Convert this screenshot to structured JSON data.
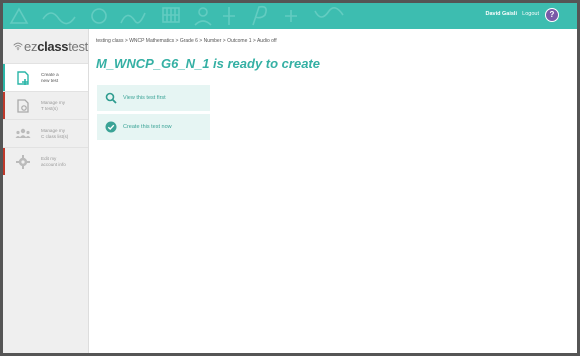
{
  "topbar": {
    "user_name": "David Gaisli",
    "logout_label": "Logout",
    "help_label": "?"
  },
  "logo": {
    "ez": "ez",
    "class": "class",
    "test": "test"
  },
  "sidebar": {
    "items": [
      {
        "label_line1": "Create a",
        "label_line2": "new test",
        "active": true,
        "accent": "#2bb6a8"
      },
      {
        "label_line1": "Manage my",
        "label_line2": "T test(s)",
        "active": false,
        "accent": "#c0392b"
      },
      {
        "label_line1": "Manage my",
        "label_line2": "C class list(s)",
        "active": false,
        "accent": "#e0e0e0"
      },
      {
        "label_line1": "Edit my",
        "label_line2": "account info",
        "active": false,
        "accent": "#c0392b"
      }
    ]
  },
  "main": {
    "breadcrumb": "testing class  >  WNCP Mathematics  >  Grade 6  >  Number  >  Outcome 1  >  Audio off",
    "title": "M_WNCP_G6_N_1 is ready to create",
    "actions": {
      "view_label": "View this test first",
      "create_label": "Create this test now"
    }
  },
  "colors": {
    "teal": "#3dbdb0",
    "teal_text": "#35b0a4",
    "action_bg": "#e6f5f3"
  }
}
